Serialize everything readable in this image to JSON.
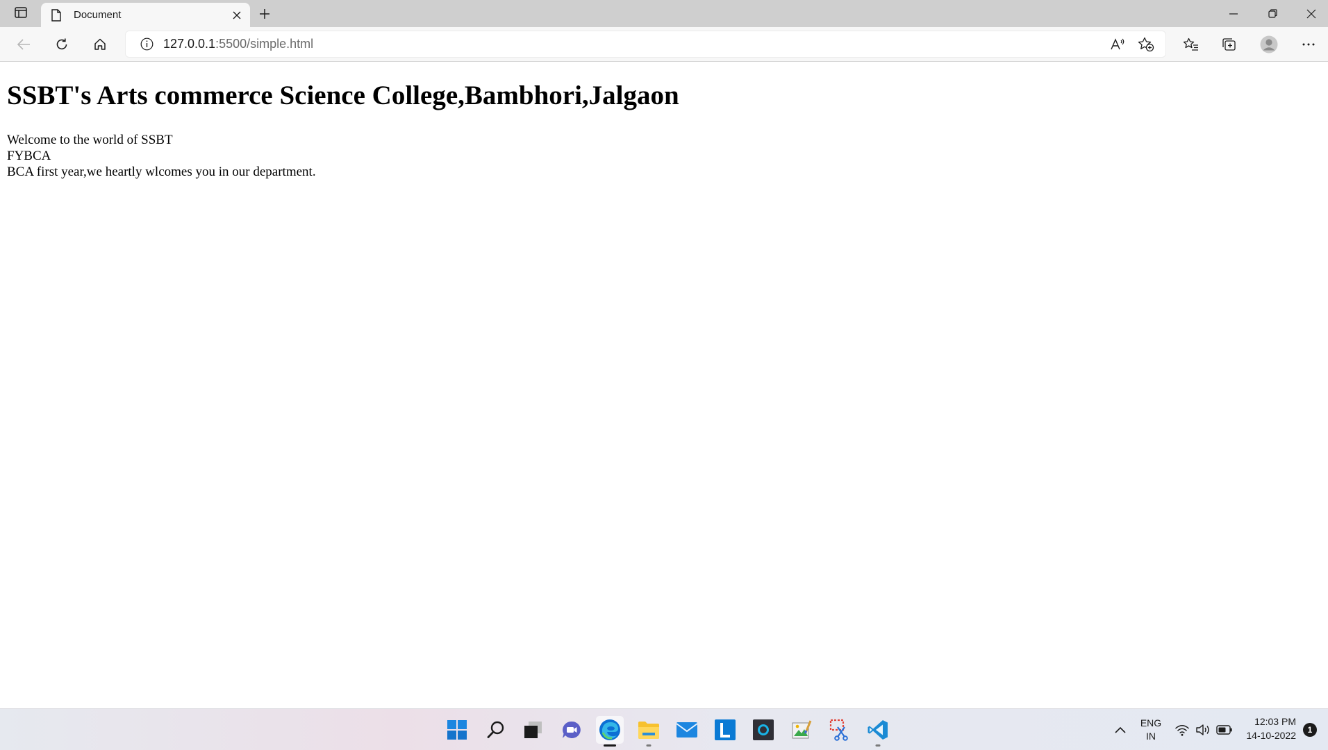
{
  "browser": {
    "tab": {
      "title": "Document"
    },
    "address": {
      "host": "127.0.0.1",
      "path": ":5500/simple.html"
    }
  },
  "page": {
    "heading": "SSBT's Arts commerce Science College,Bambhori,Jalgaon",
    "lines": [
      "Welcome to the world of SSBT",
      "FYBCA",
      "BCA first year,we heartly wlcomes you in our department."
    ]
  },
  "taskbar": {
    "apps": [
      "start-icon",
      "search-icon",
      "task-view-icon",
      "chat-icon",
      "edge-icon",
      "file-explorer-icon",
      "mail-icon",
      "l-app-icon",
      "o-app-icon",
      "paint-icon",
      "snipping-tool-icon",
      "vscode-icon"
    ],
    "tray": {
      "lang_top": "ENG",
      "lang_bottom": "IN",
      "time": "12:03 PM",
      "date": "14-10-2022",
      "notification_count": "1"
    }
  },
  "colors": {
    "titlebar": "#cfcfcf",
    "toolbar": "#f7f7f7",
    "edge_blue": "#0c6fd4",
    "vscode_blue": "#1a8ad4"
  }
}
